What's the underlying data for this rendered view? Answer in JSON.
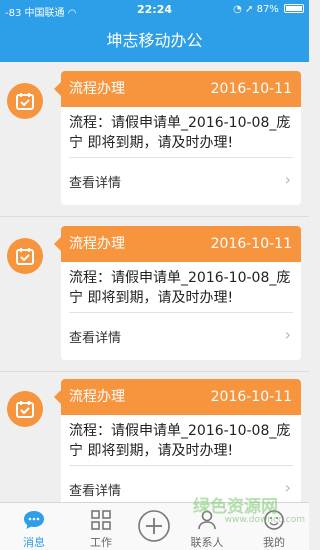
{
  "status": {
    "signal": "-83",
    "carrier": "中国联通",
    "time": "22:24",
    "battery_text": "87%",
    "battery_level": 0.87
  },
  "header": {
    "title": "坤志移动办公"
  },
  "messages": [
    {
      "type": "流程办理",
      "date": "2016-10-11",
      "body": "流程：请假申请单_2016-10-08_庞宁 即将到期，请及时办理!",
      "link": "查看详情"
    },
    {
      "type": "流程办理",
      "date": "2016-10-11",
      "body": "流程：请假申请单_2016-10-08_庞宁 即将到期，请及时办理!",
      "link": "查看详情"
    },
    {
      "type": "流程办理",
      "date": "2016-10-11",
      "body": "流程：请假申请单_2016-10-08_庞宁 即将到期，请及时办理!",
      "link": "查看详情"
    }
  ],
  "tabs": [
    {
      "label": "消息",
      "icon": "chat-bubble-icon",
      "active": true
    },
    {
      "label": "工作",
      "icon": "grid-icon",
      "active": false
    },
    {
      "label": "",
      "icon": "add-circle-icon",
      "active": false
    },
    {
      "label": "联系人",
      "icon": "contacts-icon",
      "active": false
    },
    {
      "label": "我的",
      "icon": "profile-icon",
      "active": false
    }
  ],
  "watermark": {
    "text": "绿色资源网",
    "url": "www.downcc.com"
  },
  "colors": {
    "primary": "#2d9ee8",
    "accent": "#f7953f",
    "background": "#efefef"
  }
}
